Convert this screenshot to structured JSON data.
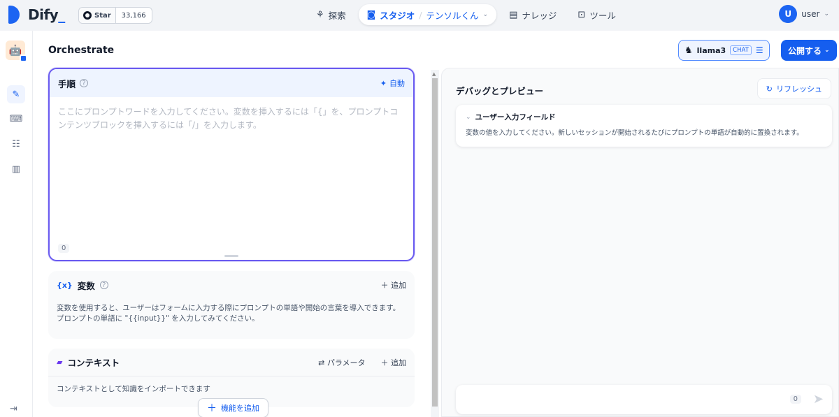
{
  "header": {
    "brand": "Dify",
    "github": {
      "star_label": "Star",
      "star_count": "33,166"
    },
    "nav": [
      {
        "label": "探索",
        "icon": "explore-icon"
      },
      {
        "label": "スタジオ",
        "sub": "テンソルくん",
        "icon": "studio-robot-icon"
      },
      {
        "label": "ナレッジ",
        "icon": "knowledge-book-icon"
      },
      {
        "label": "ツール",
        "icon": "tools-icon"
      }
    ],
    "user": {
      "initial": "U",
      "name": "user"
    }
  },
  "toolbar": {
    "title": "Orchestrate",
    "model_name": "llama3",
    "model_tag": "CHAT",
    "publish_label": "公開する"
  },
  "prompt": {
    "title": "手順",
    "auto_label": "自動",
    "placeholder": "ここにプロンプトワードを入力してください。変数を挿入するには「{」を、プロンプトコンテンツブロックを挿入するには「/」を入力します。",
    "count": "0"
  },
  "variables": {
    "title": "変数",
    "add_label": "追加",
    "description": "変数を使用すると、ユーザーはフォームに入力する際にプロンプトの単語や開始の言葉を導入できます。プロンプトの単語に \"{{input}}\" を入力してみてください。"
  },
  "context": {
    "title": "コンテキスト",
    "params_label": "パラメータ",
    "add_label": "追加",
    "description": "コンテキストとして知識をインポートできます"
  },
  "add_feature_label": "機能を追加",
  "debug": {
    "title": "デバッグとプレビュー",
    "refresh_label": "リフレッシュ",
    "input_field_title": "ユーザー入力フィールド",
    "input_field_desc": "変数の値を入力してください。新しいセッションが開始されるたびにプロンプトの単語が自動的に置換されます。",
    "chat_count": "0"
  },
  "colors": {
    "accent": "#155eef",
    "prompt_border": "#6a5bf0",
    "brand": "#1c64f2"
  }
}
